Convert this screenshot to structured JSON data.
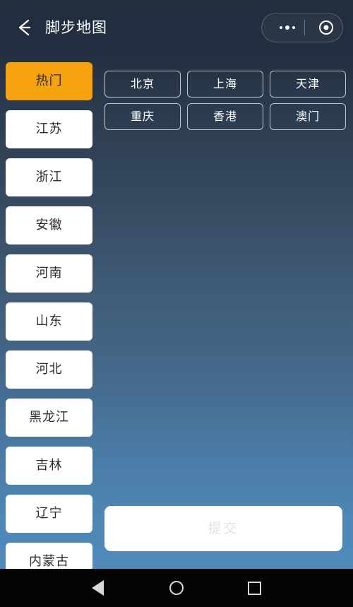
{
  "header": {
    "title": "脚步地图",
    "back_icon": "back-arrow-icon",
    "more_icon": "more-dots-icon",
    "target_icon": "target-circle-icon"
  },
  "sidebar": {
    "items": [
      {
        "label": "热门",
        "active": true
      },
      {
        "label": "江苏",
        "active": false
      },
      {
        "label": "浙江",
        "active": false
      },
      {
        "label": "安徽",
        "active": false
      },
      {
        "label": "河南",
        "active": false
      },
      {
        "label": "山东",
        "active": false
      },
      {
        "label": "河北",
        "active": false
      },
      {
        "label": "黑龙江",
        "active": false
      },
      {
        "label": "吉林",
        "active": false
      },
      {
        "label": "辽宁",
        "active": false
      },
      {
        "label": "内蒙古",
        "active": false
      }
    ]
  },
  "main": {
    "chips": [
      {
        "label": "北京"
      },
      {
        "label": "上海"
      },
      {
        "label": "天津"
      },
      {
        "label": "重庆"
      },
      {
        "label": "香港"
      },
      {
        "label": "澳门"
      }
    ],
    "submit_label": "提交"
  },
  "navbar": {
    "back_label": "back-triangle-icon",
    "home_label": "home-circle-icon",
    "recents_label": "recents-square-icon"
  },
  "colors": {
    "accent": "#f5a20e",
    "bg_top": "#222e3e",
    "bg_bottom": "#4f8abb",
    "card": "#ffffff",
    "submit_text": "#e2e2e2"
  }
}
